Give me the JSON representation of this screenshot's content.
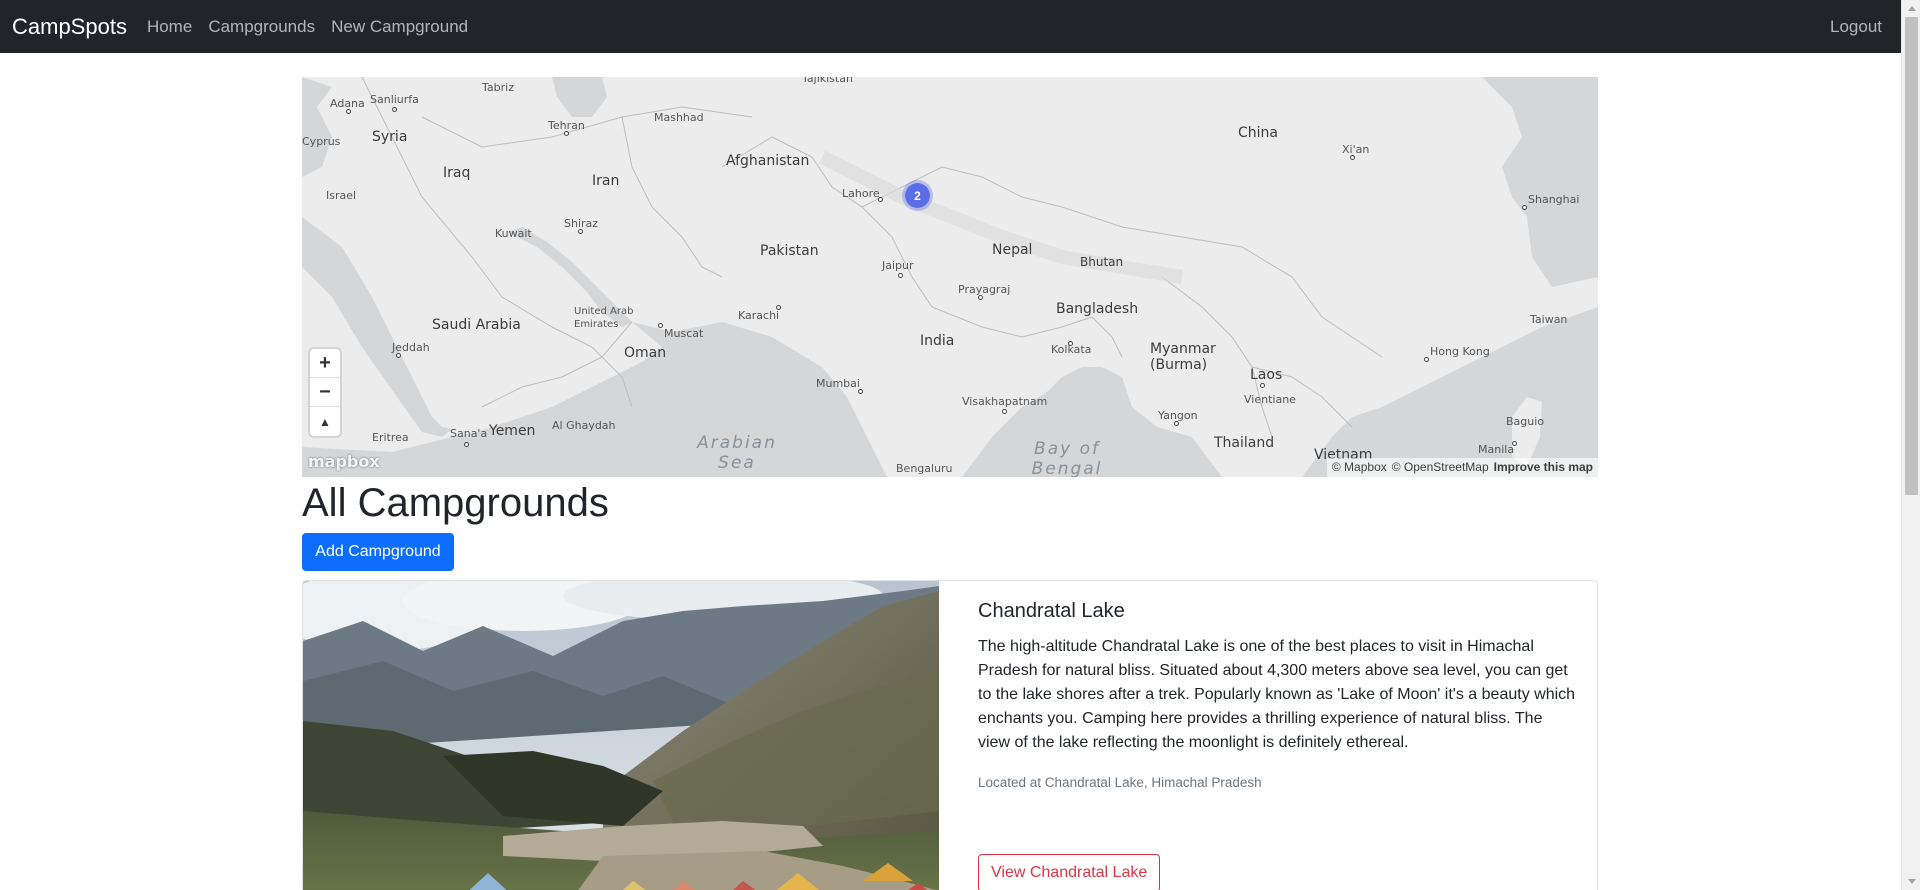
{
  "navbar": {
    "brand": "CampSpots",
    "links": [
      "Home",
      "Campgrounds",
      "New Campground"
    ],
    "logout": "Logout"
  },
  "map": {
    "countries": [
      "Syria",
      "Iraq",
      "Iran",
      "Afghanistan",
      "Pakistan",
      "Saudi Arabia",
      "Oman",
      "Yemen",
      "India",
      "Nepal",
      "Bhutan",
      "Bangladesh",
      "Myanmar (Burma)",
      "Laos",
      "Thailand",
      "Vietnam",
      "China",
      "Taiwan",
      "Kuwait",
      "United Arab Emirates",
      "Cyprus",
      "Israel",
      "Eritrea"
    ],
    "cities": [
      "Adana",
      "Sanliurfa",
      "Tabriz",
      "Tehran",
      "Mashhad",
      "Shiraz",
      "Muscat",
      "Karachi",
      "Lahore",
      "Jaipur",
      "Prayagraj",
      "Kolkata",
      "Mumbai",
      "Visakhapatnam",
      "Bengaluru",
      "Jeddah",
      "Sana'a",
      "Al Ghaydah",
      "Xi'an",
      "Shanghai",
      "Hong Kong",
      "Yangon",
      "Vientiane",
      "Manila",
      "Baguio",
      "Tajikistan"
    ],
    "seas": [
      "Arabian Sea",
      "Bay of Bengal"
    ],
    "cluster_count": "2",
    "zoom_in": "+",
    "zoom_out": "−",
    "compass": "▲",
    "logo": "mapbox",
    "attribution_mapbox": "© Mapbox",
    "attribution_osm": "© OpenStreetMap",
    "improve": "Improve this map"
  },
  "page": {
    "title": "All Campgrounds",
    "add_button": "Add Campground"
  },
  "campground": {
    "title": "Chandratal Lake",
    "description": "The high-altitude Chandratal Lake is one of the best places to visit in Himachal Pradesh for natural bliss. Situated about 4,300 meters above sea level, you can get to the lake shores after a trek. Popularly known as 'Lake of Moon' it's a beauty which enchants you. Camping here provides a thrilling experience of natural bliss. The view of the lake reflecting the moonlight is definitely ethereal.",
    "location": "Located at Chandratal Lake, Himachal Pradesh",
    "view_button": "View Chandratal Lake"
  },
  "colors": {
    "navbar_bg": "#212529",
    "primary": "#0d6efd",
    "danger": "#dc3545",
    "cluster": "#5b6ee8"
  }
}
